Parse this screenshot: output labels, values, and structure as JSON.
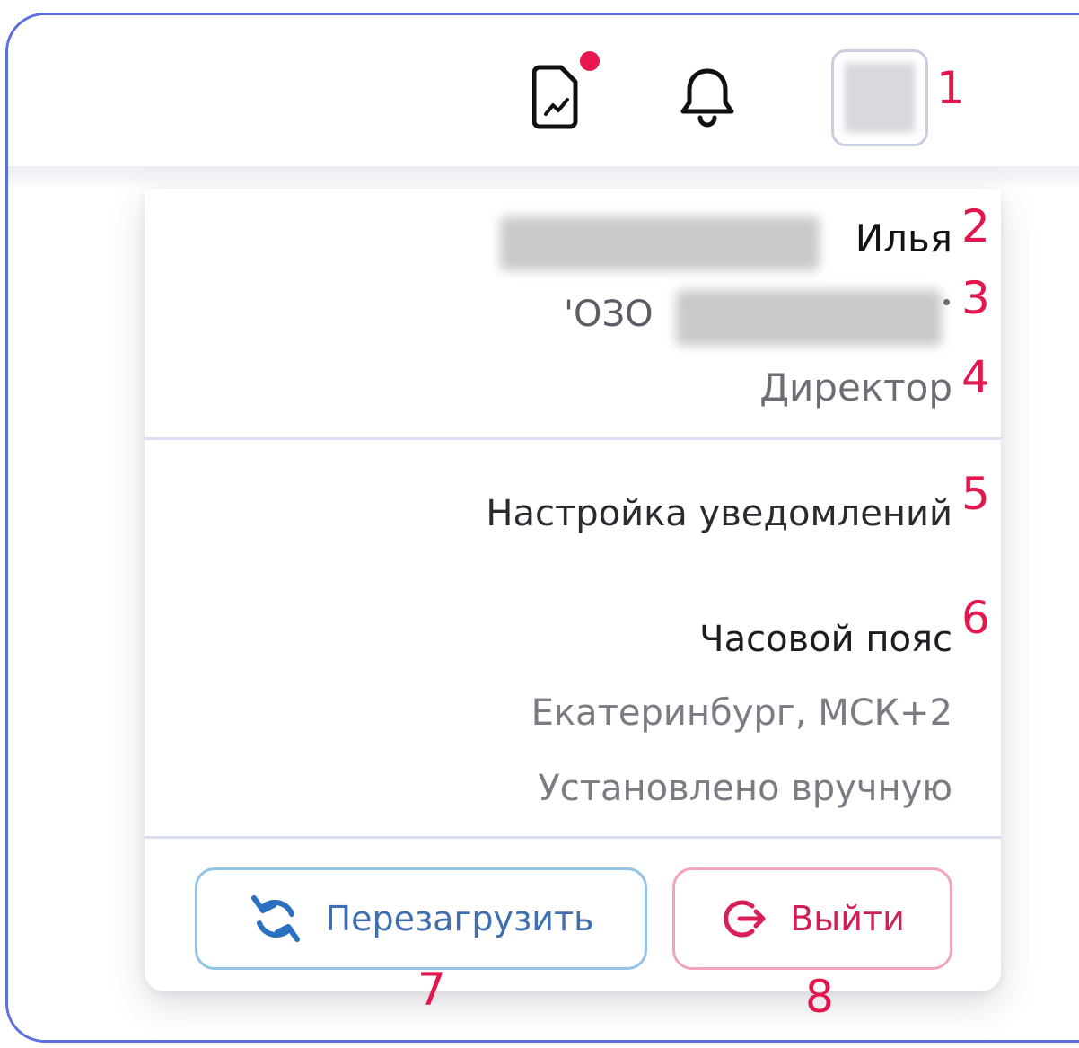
{
  "header": {
    "icons": [
      "report-icon",
      "bell-icon"
    ],
    "report_has_notification": true
  },
  "profile": {
    "name": "Илья",
    "org_prefix": "'ОЗО",
    "role": "Директор"
  },
  "menu": {
    "notifications_label": "Настройка уведомлений",
    "timezone_title": "Часовой пояс",
    "timezone_value": "Екатеринбург, МСК+2",
    "timezone_mode": "Установлено вручную"
  },
  "buttons": {
    "reload_label": "Перезагрузить",
    "logout_label": "Выйти"
  },
  "annotations": {
    "n1": "1",
    "n2": "2",
    "n3": "3",
    "n4": "4",
    "n5": "5",
    "n6": "6",
    "n7": "7",
    "n8": "8"
  },
  "colors": {
    "accent_frame": "#5b6fe0",
    "annotation": "#e3164d",
    "reload": "#3f6fb0",
    "logout": "#cf1f55",
    "badge": "#e8174e"
  }
}
